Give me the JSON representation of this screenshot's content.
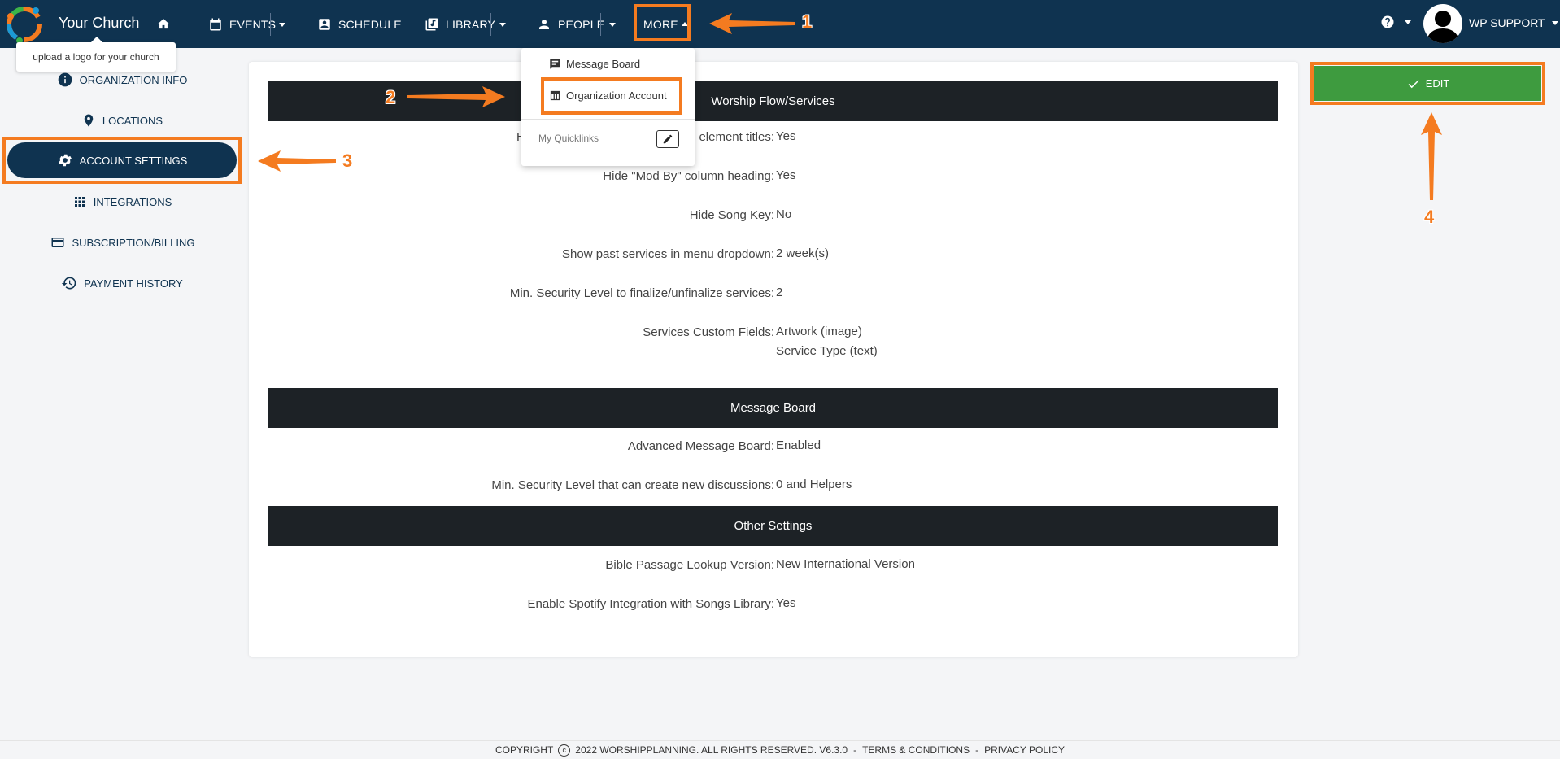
{
  "navbar": {
    "brand": "Your Church",
    "items": [
      {
        "label": "EVENTS"
      },
      {
        "label": "SCHEDULE"
      },
      {
        "label": "LIBRARY"
      },
      {
        "label": "PEOPLE"
      },
      {
        "label": "MORE"
      }
    ],
    "user": "WP SUPPORT"
  },
  "tooltip": "upload a logo for your church",
  "dropdown": {
    "items": [
      "Message Board",
      "Organization Account"
    ],
    "quicklinks_label": "My Quicklinks"
  },
  "sidebar": {
    "items": [
      {
        "label": "ORGANIZATION INFO"
      },
      {
        "label": "LOCATIONS"
      },
      {
        "label": "ACCOUNT SETTINGS"
      },
      {
        "label": "INTEGRATIONS"
      },
      {
        "label": "SUBSCRIPTION/BILLING"
      },
      {
        "label": "PAYMENT HISTORY"
      }
    ]
  },
  "edit_label": "EDIT",
  "sections": [
    {
      "title": "Worship Flow/Services",
      "rows": [
        {
          "key": "H",
          "key_tail": "element titles:",
          "value": "Yes"
        },
        {
          "key": "Hide \"Mod By\" column heading:",
          "value": "Yes"
        },
        {
          "key": "Hide Song Key:",
          "value": "No"
        },
        {
          "key": "Show past services in menu dropdown:",
          "value": "2 week(s)"
        },
        {
          "key": "Min. Security Level to finalize/unfinalize services:",
          "value": "2"
        },
        {
          "key": "Services Custom Fields:",
          "value": "Artwork (image)",
          "value2": "Service Type (text)"
        }
      ]
    },
    {
      "title": "Message Board",
      "rows": [
        {
          "key": "Advanced Message Board:",
          "value": "Enabled"
        },
        {
          "key": "Min. Security Level that can create new discussions:",
          "value": "0 and Helpers"
        }
      ]
    },
    {
      "title": "Other Settings",
      "rows": [
        {
          "key": "Bible Passage Lookup Version:",
          "value": "New International Version"
        },
        {
          "key": "Enable Spotify Integration with Songs Library:",
          "value": "Yes"
        }
      ]
    }
  ],
  "footer": {
    "copyright_label": "COPYRIGHT",
    "text": "2022 WORSHIPPLANNING. ALL RIGHTS RESERVED. V6.3.0",
    "terms": "TERMS & CONDITIONS",
    "privacy": "PRIVACY POLICY"
  },
  "annotations": [
    "1",
    "2",
    "3",
    "4"
  ],
  "colors": {
    "navbar": "#0f3350",
    "highlight": "#f47b20",
    "edit_button": "#3e9b3f",
    "section_header": "#1d2226"
  }
}
